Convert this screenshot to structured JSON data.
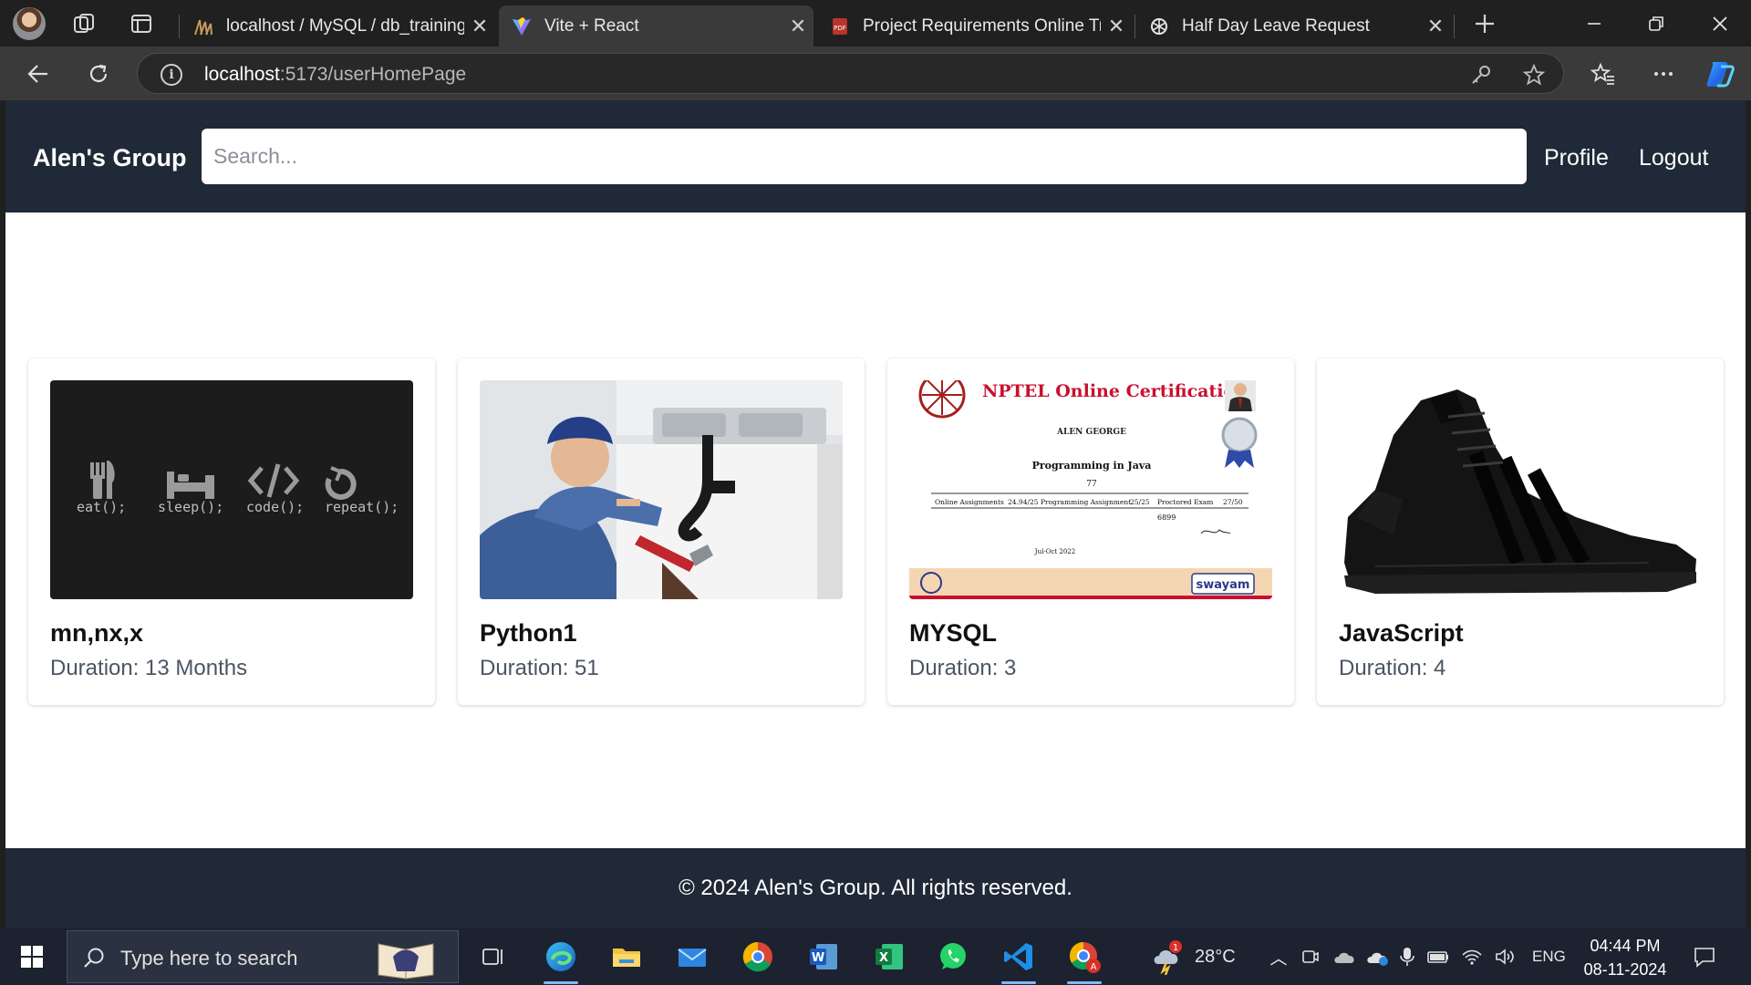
{
  "browser": {
    "tabs": [
      {
        "title": "localhost / MySQL / db_training",
        "favicon": "phpmyadmin-icon",
        "active": false
      },
      {
        "title": "Vite + React",
        "favicon": "vite-icon",
        "active": true
      },
      {
        "title": "Project Requirements Online Trai",
        "favicon": "pdf-icon",
        "active": false
      },
      {
        "title": "Half Day Leave Request",
        "favicon": "chatgpt-icon",
        "active": false
      }
    ],
    "address": {
      "host": "localhost",
      "path": ":5173/userHomePage"
    }
  },
  "app": {
    "brand": "Alen's Group",
    "search_placeholder": "Search...",
    "nav": {
      "profile": "Profile",
      "logout": "Logout"
    },
    "courses": [
      {
        "title": "mn,nx,x",
        "duration": "Duration: 13 Months",
        "image": "eat-sleep-code-repeat"
      },
      {
        "title": "Python1",
        "duration": "Duration: 51",
        "image": "plumber-photo"
      },
      {
        "title": "MYSQL",
        "duration": "Duration: 3",
        "image": "nptel-certificate"
      },
      {
        "title": "JavaScript",
        "duration": "Duration: 4",
        "image": "black-sneaker"
      }
    ],
    "thumb_text": {
      "eat": "eat();",
      "sleep": "sleep();",
      "code": "code();",
      "repeat": "repeat();",
      "cert_title": "NPTEL Online Certification",
      "cert_name": "ALEN GEORGE",
      "cert_course": "Programming in Java",
      "cert_score": "77",
      "cert_online": "Online Assignments",
      "cert_online_score": "24.94/25",
      "cert_prog": "Programming Assignment",
      "cert_prog_score": "25/25",
      "cert_exam": "Proctored Exam",
      "cert_exam_score": "27/50",
      "cert_total": "6899",
      "cert_period": "Jul-Oct 2022",
      "cert_brand": "swayam"
    },
    "footer": "© 2024 Alen's Group. All rights reserved."
  },
  "taskbar": {
    "search_placeholder": "Type here to search",
    "weather": "28°C",
    "language": "ENG",
    "time": "04:44 PM",
    "date": "08-11-2024"
  }
}
